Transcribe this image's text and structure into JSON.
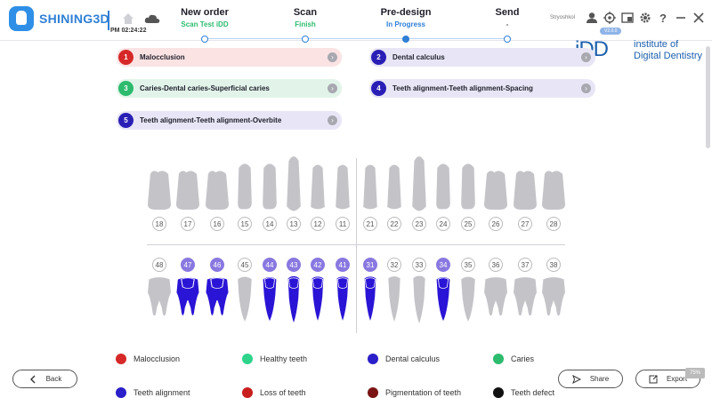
{
  "app": {
    "brand": "SHINING3D",
    "time": "PM 02:24:22",
    "user": "Stryoshkol"
  },
  "steps": [
    {
      "title": "New order",
      "sub": "Scan Test iDD",
      "state": "done"
    },
    {
      "title": "Scan",
      "sub": "Finish",
      "state": "done"
    },
    {
      "title": "Pre-design",
      "sub": "In Progress",
      "state": "active"
    },
    {
      "title": "Send",
      "sub": "-",
      "state": "pending"
    }
  ],
  "idd": {
    "chip": "V2.0.0",
    "mark": "iDD",
    "line1": "institute of",
    "line2": "Digital Dentistry"
  },
  "findings": [
    {
      "num": "1",
      "label": "Malocclusion",
      "color": "#d62828",
      "bg": "#fbe3e3"
    },
    {
      "num": "2",
      "label": "Dental calculus",
      "color": "#2a1fb5",
      "bg": "#e8e6f6"
    },
    {
      "num": "3",
      "label": "Caries-Dental caries-Superficial caries",
      "color": "#2dbb6e",
      "bg": "#e2f4ea"
    },
    {
      "num": "4",
      "label": "Teeth alignment-Teeth alignment-Spacing",
      "color": "#2a1fb5",
      "bg": "#e8e6f6"
    },
    {
      "num": "5",
      "label": "Teeth alignment-Teeth alignment-Overbite",
      "color": "#2a1fb5",
      "bg": "#e8e6f6"
    }
  ],
  "upper_teeth": [
    "18",
    "17",
    "16",
    "15",
    "14",
    "13",
    "12",
    "11",
    "21",
    "22",
    "23",
    "24",
    "25",
    "26",
    "27",
    "28"
  ],
  "lower_teeth": [
    "48",
    "47",
    "46",
    "45",
    "44",
    "43",
    "42",
    "41",
    "31",
    "32",
    "33",
    "34",
    "35",
    "36",
    "37",
    "38"
  ],
  "lower_highlight": [
    "47",
    "46",
    "44",
    "43",
    "42",
    "41",
    "31",
    "34"
  ],
  "legend": [
    {
      "label": "Malocclusion",
      "color": "#d62828"
    },
    {
      "label": "Healthy teeth",
      "color": "#2dd48a"
    },
    {
      "label": "Dental calculus",
      "color": "#2a1fc8"
    },
    {
      "label": "Caries",
      "color": "#2dbb6e"
    },
    {
      "label": "Teeth alignment",
      "color": "#2a1fc8"
    },
    {
      "label": "Loss of teeth",
      "color": "#c81e1e"
    },
    {
      "label": "Pigmentation of teeth",
      "color": "#7a1414"
    },
    {
      "label": "Teeth defect",
      "color": "#111111"
    }
  ],
  "buttons": {
    "back": "Back",
    "share": "Share",
    "export": "Export"
  },
  "corner": "75%",
  "colors": {
    "accent": "#2f7fd6",
    "tooth_grey": "#c4c4c8",
    "tooth_blue": "#2a14d6"
  }
}
